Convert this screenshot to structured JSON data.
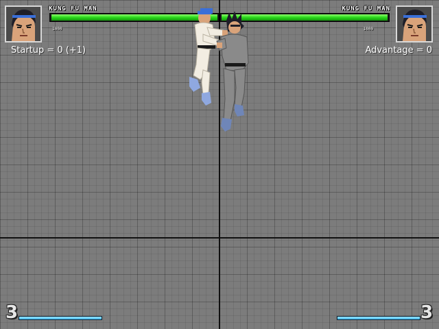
{
  "players": {
    "p1": {
      "name": "KUNG FU MAN",
      "life_fraction": 1.0,
      "power_label": "1000",
      "debug_text": "Startup = 0 (+1)",
      "power_level": "3",
      "power_fraction": 1.0,
      "portrait_icon": "kung-fu-man-portrait"
    },
    "p2": {
      "name": "KUNG FU MAN",
      "life_fraction": 1.0,
      "power_label": "1000",
      "debug_text": "Advantage = 0",
      "power_level": "3",
      "power_fraction": 1.0,
      "portrait_icon": "kung-fu-man-portrait"
    }
  },
  "colors": {
    "life": "#29d61a",
    "power": "#3fb6ec",
    "grid_bg": "#7c7c7c",
    "p1_gi": "#f2ede2",
    "p2_gi": "#8a8a8a"
  },
  "fighters": [
    {
      "id": "p1",
      "pose": "grab",
      "outfit": "white-gi"
    },
    {
      "id": "p2",
      "pose": "hit-reel",
      "outfit": "grey-gi"
    }
  ]
}
